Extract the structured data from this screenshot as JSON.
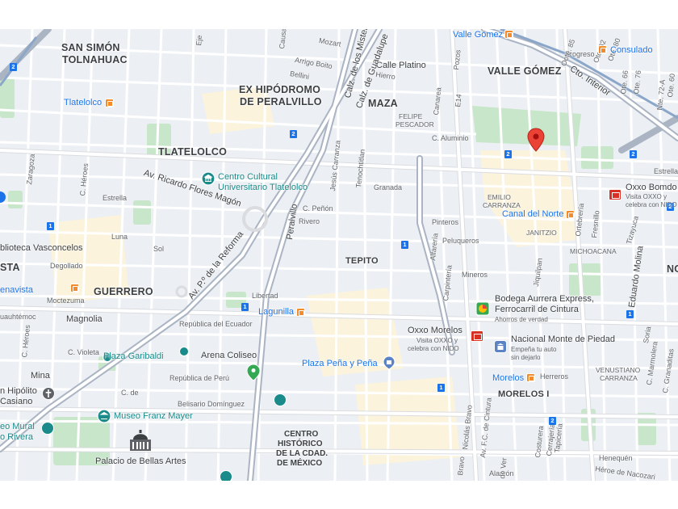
{
  "map": {
    "colors": {
      "background": "#eceff3",
      "road": "#ffffff",
      "arterial": "#dadce0",
      "highway": "#aab4c3",
      "park": "#c8e6c9",
      "block": "#fef7e0",
      "water": "#aadaff",
      "accent_blue": "#1a73e8",
      "accent_teal": "#1a8a8a",
      "marker_red": "#ea4335"
    },
    "neighborhoods": {
      "san_simon": "SAN SIMÓN\nTOLNAHUAC",
      "ex_hipodromo": "EX HIPÓDROMO\nDE PERALVILLO",
      "maza": "MAZA",
      "valle_gomez": "VALLE GÓMEZ",
      "tlatelolco": "TLATELOLCO",
      "tepito": "TEPITO",
      "guerrero": "GUERRERO",
      "morelos": "MORELOS I",
      "centro": "CENTRO\nHISTÓRICO\nDE LA CDAD.\nDE MÉXICO",
      "felipe_pescador": "FELIPE\nPESCADOR",
      "emilio_carranza": "EMILIO\nCARRANZA",
      "janitzio": "JANITZIO",
      "michoacana": "MICHOACANA",
      "venustiano": "VENUSTIANO\nCARRANZA",
      "no": "NO",
      "sta": "STA"
    },
    "streets": {
      "calle_platino": "Calle Platino",
      "calz_misterios": "Calz. de los Misterios",
      "calz_guadalupe": "Calz. de Guadalupe",
      "cto_interior": "Cto. Interior",
      "av_ricardo": "Av. Ricardo Flores Magón",
      "av_reforma": "Av. P.º de la Reforma",
      "peralvillo": "Peralvillo",
      "c_aluminio": "C. Aluminio",
      "estrella": "Estrella",
      "magnolia": "Magnolia",
      "mina": "Mina",
      "libertad": "Libertad",
      "republica_ecuador": "República del Ecuador",
      "republica_peru": "República de Perú",
      "belisario": "Belisario Domínguez",
      "eduardo_molina": "Eduardo Molina",
      "jesus_carranza": "Jesús Carranza",
      "tenochtitlan": "Tenochtitlan",
      "granada": "Granada",
      "c_penon": "C. Peñón",
      "rivero": "Rivero",
      "sol": "Sol",
      "luna": "Luna",
      "degollado": "Degollado",
      "moctezuma": "Moctezuma",
      "c_heroes": "C. Héroes",
      "c_violeta": "C. Violeta",
      "pinteros": "Pinteros",
      "peluqueros": "Peluqueros",
      "mineros": "Mineros",
      "alfareria": "Alfarería",
      "carpinteria": "Carpintería",
      "herreros": "Herreros",
      "alarcon": "Alarcón",
      "jiquilpan": "Jiquilpan",
      "nicolas_bravo": "Nicolás Bravo",
      "av_fc_cintura": "Av. F.C. de Cintura",
      "zaragoza": "Zaragoza",
      "eje": "Eje",
      "mozart": "Mozart",
      "arrigo_boito": "Arrigo Boito",
      "bellini": "Bellini",
      "causa": "Causa",
      "hierro": "Hierro",
      "canarea": "Canarea",
      "e14": "E14",
      "pozos": "Pozos",
      "progreso": "Progreso",
      "oote": "Oote. 85",
      "ote_80": "Ote. 80",
      "ote_82": "Ote. 82",
      "ote_76": "Ote. 76",
      "ote_66": "Ote. 66",
      "ote_50": "Ote. 50",
      "ote_60": "Ote. 60",
      "nte_72a": "Nte. 72-A",
      "fresnillo": "Fresnillo",
      "ortebreria": "Ortebrería",
      "tizayuca": "Tizayuca",
      "estrella_e": "Estrella",
      "soria": "Soria",
      "c_marmolera": "C. Marmolera",
      "c_granaditas": "C. Granaditas",
      "tapiceria": "Tapicería",
      "costurera": "Costurera",
      "cerrajeria": "Cerrajería",
      "henequen": "Henequén",
      "nacozari": "Héroe de Nacozari",
      "bravo": "Bravo",
      "de_ver": "de Ver",
      "c_de": "C. de",
      "cuauhtemoc": "uauhtémoc",
      "c_heroes2": "C. Héroes"
    },
    "pois": {
      "tlatelolco_metro": "Tlatelolco",
      "valle_gomez_metro": "Valle Gómez",
      "consulado": "Consulado",
      "centro_cultural": "Centro Cultural\nUniversitario Tlatelolco",
      "canal_norte": "Canal del Norte",
      "oxxo_bomdo": "Oxxo Bomdo",
      "oxxo_bomdo_sub": "Visita OXXO y\ncelebra con NIDO",
      "bodega": "Bodega Aurrera Express,\nFerrocarril de Cintura",
      "bodega_sub": "Ahorros de verdad",
      "oxxo_morelos": "Oxxo Morelos",
      "oxxo_morelos_sub": "Visita OXXO y\ncelebra con NIDO",
      "monte_piedad": "Nacional Monte de Piedad",
      "monte_piedad_sub": "Empeña tu auto\nsin dejarlo",
      "lagunilla": "Lagunilla",
      "garibaldi": "Plaza Garibaldi",
      "arena_coliseo": "Arena Coliseo",
      "plaza_pena": "Plaza Peña y Peña",
      "morelos_metro": "Morelos",
      "museo_franz": "Museo Franz Mayer",
      "palacio": "Palacio de Bellas Artes",
      "biblioteca": "blioteca Vasconcelos",
      "buenavista": "enavista",
      "san_hipolito": "n Hipólito\nCasiano",
      "museo_mural": "eo Mural\no Rivera"
    },
    "shields": {
      "s1": "2",
      "s2": "2",
      "s3": "2",
      "s4": "2",
      "s5": "1",
      "s6": "1",
      "s7": "1",
      "s8": "1",
      "s9": "1",
      "s10": "2",
      "s11": "2"
    }
  }
}
